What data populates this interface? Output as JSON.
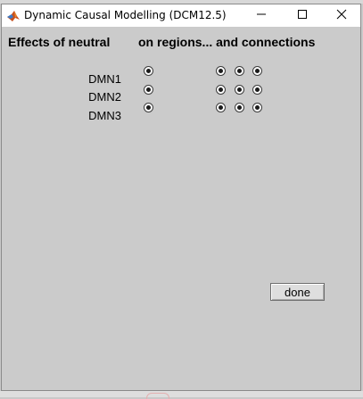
{
  "window": {
    "title": "Dynamic Causal Modelling (DCM12.5)",
    "icon": "matlab-logo-icon"
  },
  "titlebar_buttons": {
    "minimize": "minimize-icon",
    "maximize": "maximize-icon",
    "close": "close-icon"
  },
  "panel": {
    "heading_effects": "Effects of neutral",
    "heading_regions": "on regions... and connections",
    "regions": [
      {
        "label": "DMN1",
        "region_checked": true,
        "connections_checked": [
          true,
          true,
          true
        ]
      },
      {
        "label": "DMN2",
        "region_checked": true,
        "connections_checked": [
          true,
          true,
          true
        ]
      },
      {
        "label": "DMN3",
        "region_checked": true,
        "connections_checked": [
          true,
          true,
          true
        ]
      }
    ]
  },
  "buttons": {
    "done_label": "done"
  }
}
